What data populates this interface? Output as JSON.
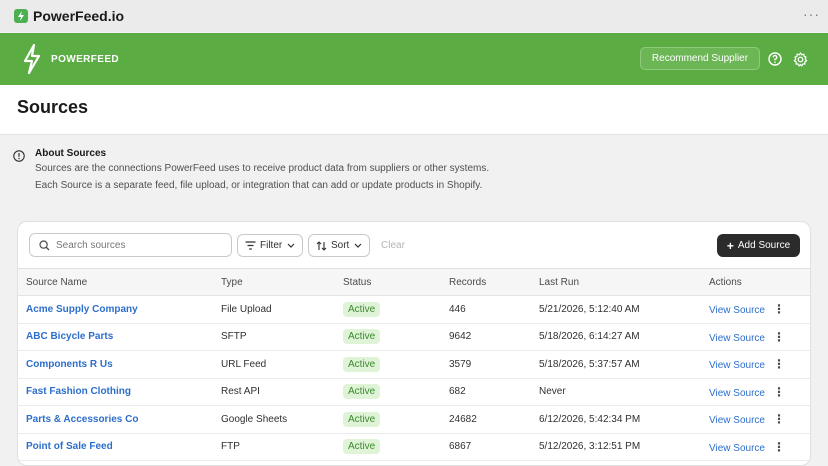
{
  "app": {
    "title": "PowerFeed.io",
    "more": "···"
  },
  "header": {
    "brand": "POWERFEED",
    "recommend_label": "Recommend Supplier"
  },
  "page": {
    "title": "Sources"
  },
  "about": {
    "title": "About Sources",
    "line1": "Sources are the connections PowerFeed uses to receive product data from suppliers or other systems.",
    "line2": "Each Source is a separate feed, file upload, or integration that can add or update products in Shopify."
  },
  "toolbar": {
    "search_placeholder": "Search sources",
    "filter_label": "Filter",
    "sort_label": "Sort",
    "clear_label": "Clear",
    "add_label": "Add Source"
  },
  "table": {
    "columns": [
      "Source Name",
      "Type",
      "Status",
      "Records",
      "Last Run",
      "Actions"
    ],
    "rows": [
      {
        "name": "Acme Supply Company",
        "type": "File Upload",
        "status": "Active",
        "records": "446",
        "last_run": "5/21/2026, 5:12:40 AM",
        "action": "View Source"
      },
      {
        "name": "ABC Bicycle Parts",
        "type": "SFTP",
        "status": "Active",
        "records": "9642",
        "last_run": "5/18/2026, 6:14:27 AM",
        "action": "View Source"
      },
      {
        "name": "Components R Us",
        "type": "URL Feed",
        "status": "Active",
        "records": "3579",
        "last_run": "5/18/2026, 5:37:57 AM",
        "action": "View Source"
      },
      {
        "name": "Fast Fashion Clothing",
        "type": "Rest API",
        "status": "Active",
        "records": "682",
        "last_run": "Never",
        "action": "View Source"
      },
      {
        "name": "Parts & Accessories Co",
        "type": "Google Sheets",
        "status": "Active",
        "records": "24682",
        "last_run": "6/12/2026, 5:42:34 PM",
        "action": "View Source"
      },
      {
        "name": "Point of Sale Feed",
        "type": "FTP",
        "status": "Active",
        "records": "6867",
        "last_run": "5/12/2026, 3:12:51 PM",
        "action": "View Source"
      }
    ]
  },
  "colors": {
    "brand_green": "#5aac43",
    "link_blue": "#2c6ecb",
    "badge_bg": "#dff3d7"
  }
}
